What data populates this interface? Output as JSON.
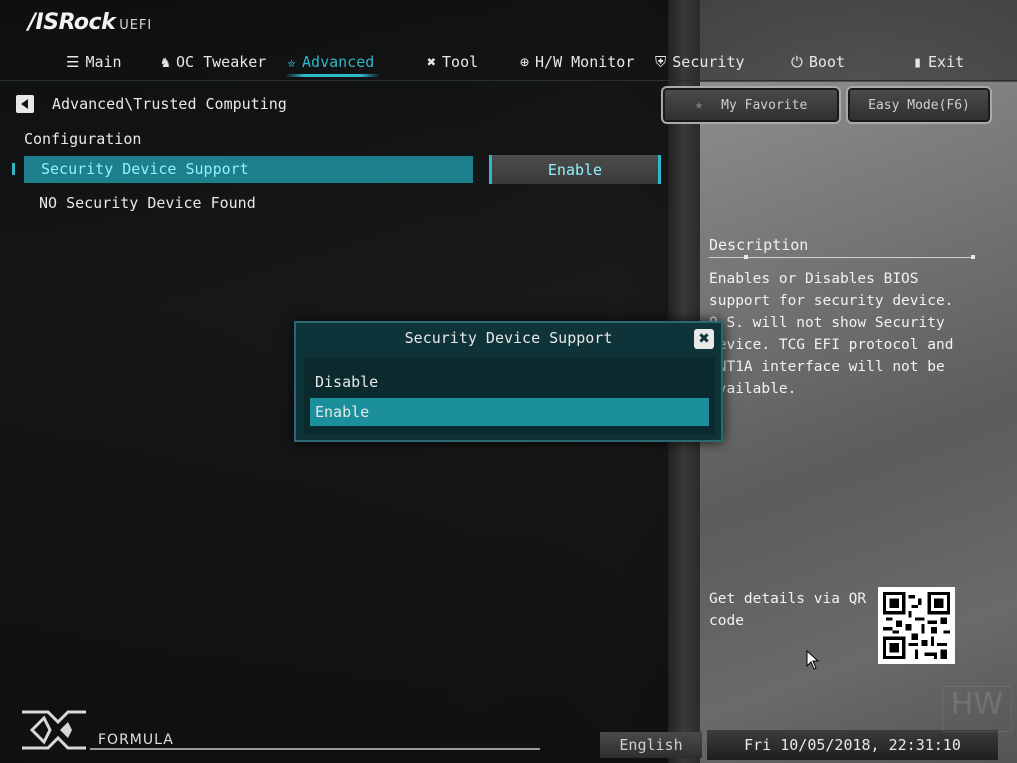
{
  "header": {
    "logo_main": "/ISRock",
    "logo_sub": "UEFI"
  },
  "nav": {
    "tabs": [
      {
        "label": "Main",
        "icon": "list-icon"
      },
      {
        "label": "OC Tweaker",
        "icon": "rocket-icon"
      },
      {
        "label": "Advanced",
        "icon": "star-icon",
        "active": true
      },
      {
        "label": "Tool",
        "icon": "tools-icon"
      },
      {
        "label": "H/W Monitor",
        "icon": "crosshair-icon"
      },
      {
        "label": "Security",
        "icon": "shield-icon"
      },
      {
        "label": "Boot",
        "icon": "power-icon"
      },
      {
        "label": "Exit",
        "icon": "door-icon"
      }
    ]
  },
  "breadcrumb": "Advanced\\Trusted Computing",
  "buttons": {
    "favorite": "My Favorite",
    "easy_mode": "Easy Mode(F6)"
  },
  "main": {
    "section_title": "Configuration",
    "selected_item": {
      "label": "Security Device Support",
      "value": "Enable"
    },
    "info_line": "NO Security Device Found"
  },
  "description": {
    "title": "Description",
    "text": "Enables or Disables BIOS support for security device. O.S. will not show Security Device. TCG EFI protocol and INT1A interface will not be available."
  },
  "qr": {
    "label": "Get details via QR code"
  },
  "dialog": {
    "title": "Security Device Support",
    "close": "✖",
    "options": [
      "Disable",
      "Enable"
    ],
    "selected": "Enable"
  },
  "footer": {
    "brand": "FORMULA",
    "language": "English",
    "datetime": "Fri 10/05/2018, 22:31:10",
    "watermark": "HW"
  },
  "colors": {
    "accent": "#2fb8c8",
    "selected_row": "#1d7e8c",
    "dialog_bg": "#0e3338"
  }
}
